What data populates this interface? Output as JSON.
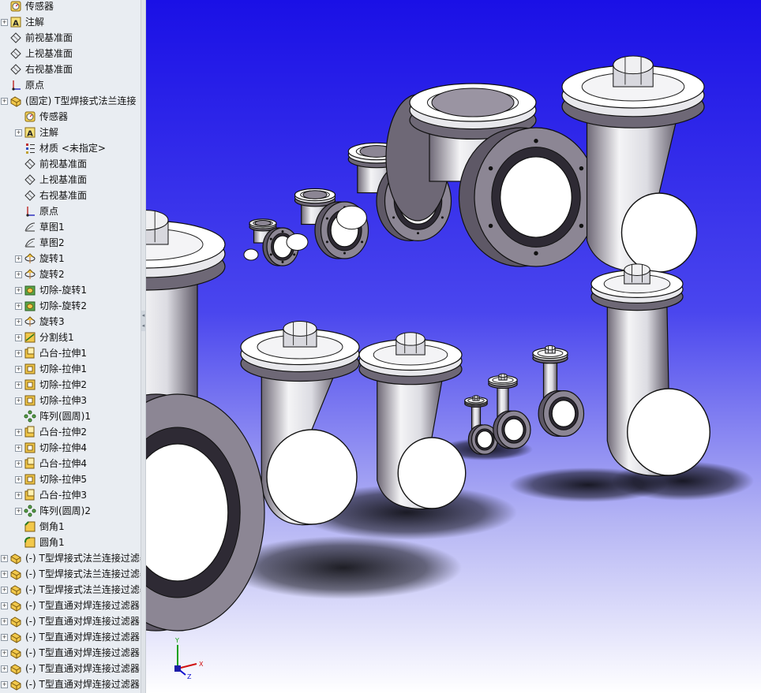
{
  "tree": {
    "items": [
      {
        "label": "传感器",
        "level": 0,
        "icon": "sensor-icon",
        "expandable": false
      },
      {
        "label": "注解",
        "level": 0,
        "icon": "annotation-icon",
        "expandable": true
      },
      {
        "label": "前视基准面",
        "level": 0,
        "icon": "plane-icon",
        "expandable": false
      },
      {
        "label": "上视基准面",
        "level": 0,
        "icon": "plane-icon",
        "expandable": false
      },
      {
        "label": "右视基准面",
        "level": 0,
        "icon": "plane-icon",
        "expandable": false
      },
      {
        "label": "原点",
        "level": 0,
        "icon": "origin-icon",
        "expandable": false
      },
      {
        "label": "(固定) T型焊接式法兰连接",
        "level": 0,
        "icon": "part-icon",
        "expandable": true
      },
      {
        "label": "传感器",
        "level": 1,
        "icon": "sensor-icon",
        "expandable": false
      },
      {
        "label": "注解",
        "level": 1,
        "icon": "annotation-icon",
        "expandable": true
      },
      {
        "label": "材质 <未指定>",
        "level": 1,
        "icon": "material-icon",
        "expandable": false
      },
      {
        "label": "前视基准面",
        "level": 1,
        "icon": "plane-icon",
        "expandable": false
      },
      {
        "label": "上视基准面",
        "level": 1,
        "icon": "plane-icon",
        "expandable": false
      },
      {
        "label": "右视基准面",
        "level": 1,
        "icon": "plane-icon",
        "expandable": false
      },
      {
        "label": "原点",
        "level": 1,
        "icon": "origin-icon",
        "expandable": false
      },
      {
        "label": "草图1",
        "level": 1,
        "icon": "sketch-icon",
        "expandable": false
      },
      {
        "label": "草图2",
        "level": 1,
        "icon": "sketch-icon",
        "expandable": false
      },
      {
        "label": "旋转1",
        "level": 1,
        "icon": "revolve-icon",
        "expandable": true
      },
      {
        "label": "旋转2",
        "level": 1,
        "icon": "revolve-icon",
        "expandable": true
      },
      {
        "label": "切除-旋转1",
        "level": 1,
        "icon": "cut-revolve-icon",
        "expandable": true
      },
      {
        "label": "切除-旋转2",
        "level": 1,
        "icon": "cut-revolve-icon",
        "expandable": true
      },
      {
        "label": "旋转3",
        "level": 1,
        "icon": "revolve-icon",
        "expandable": true
      },
      {
        "label": "分割线1",
        "level": 1,
        "icon": "split-line-icon",
        "expandable": true
      },
      {
        "label": "凸台-拉伸1",
        "level": 1,
        "icon": "boss-extrude-icon",
        "expandable": true
      },
      {
        "label": "切除-拉伸1",
        "level": 1,
        "icon": "cut-extrude-icon",
        "expandable": true
      },
      {
        "label": "切除-拉伸2",
        "level": 1,
        "icon": "cut-extrude-icon",
        "expandable": true
      },
      {
        "label": "切除-拉伸3",
        "level": 1,
        "icon": "cut-extrude-icon",
        "expandable": true
      },
      {
        "label": "阵列(圆周)1",
        "level": 1,
        "icon": "circular-pattern-icon",
        "expandable": false
      },
      {
        "label": "凸台-拉伸2",
        "level": 1,
        "icon": "boss-extrude-icon",
        "expandable": true
      },
      {
        "label": "切除-拉伸4",
        "level": 1,
        "icon": "cut-extrude-icon",
        "expandable": true
      },
      {
        "label": "凸台-拉伸4",
        "level": 1,
        "icon": "boss-extrude-icon",
        "expandable": true
      },
      {
        "label": "切除-拉伸5",
        "level": 1,
        "icon": "cut-extrude-icon",
        "expandable": true
      },
      {
        "label": "凸台-拉伸3",
        "level": 1,
        "icon": "boss-extrude-icon",
        "expandable": true
      },
      {
        "label": "阵列(圆周)2",
        "level": 1,
        "icon": "circular-pattern-icon",
        "expandable": true
      },
      {
        "label": "倒角1",
        "level": 1,
        "icon": "chamfer-icon",
        "expandable": false
      },
      {
        "label": "圆角1",
        "level": 1,
        "icon": "fillet-icon",
        "expandable": false
      },
      {
        "label": "(-) T型焊接式法兰连接过滤器",
        "level": 0,
        "icon": "part-icon",
        "expandable": true
      },
      {
        "label": "(-) T型焊接式法兰连接过滤器",
        "level": 0,
        "icon": "part-icon",
        "expandable": true
      },
      {
        "label": "(-) T型焊接式法兰连接过滤器",
        "level": 0,
        "icon": "part-icon",
        "expandable": true
      },
      {
        "label": "(-) T型直通对焊连接过滤器",
        "level": 0,
        "icon": "part-icon",
        "expandable": true
      },
      {
        "label": "(-) T型直通对焊连接过滤器",
        "level": 0,
        "icon": "part-icon",
        "expandable": true
      },
      {
        "label": "(-) T型直通对焊连接过滤器",
        "level": 0,
        "icon": "part-icon",
        "expandable": true
      },
      {
        "label": "(-) T型直通对焊连接过滤器",
        "level": 0,
        "icon": "part-icon",
        "expandable": true
      },
      {
        "label": "(-) T型直通对焊连接过滤器",
        "level": 0,
        "icon": "part-icon",
        "expandable": true
      },
      {
        "label": "(-) T型直通对焊连接过滤器",
        "level": 0,
        "icon": "part-icon",
        "expandable": true
      }
    ]
  },
  "triad": {
    "x_label": "X",
    "y_label": "Y",
    "z_label": "Z"
  },
  "colors": {
    "panel_bg": "#e9edf2",
    "viewport_top": "#1a10e6",
    "viewport_bottom": "#ffffff",
    "axis_x": "#d01010",
    "axis_y": "#10a010",
    "axis_z": "#1010d0"
  }
}
